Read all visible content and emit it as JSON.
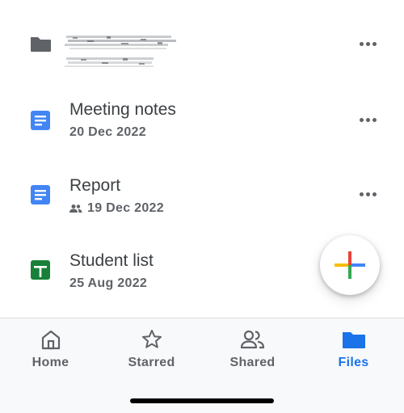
{
  "files": [
    {
      "type": "folder",
      "title": "",
      "subtitle": "",
      "shared": false
    },
    {
      "type": "doc",
      "title": "Meeting notes",
      "subtitle": "20 Dec 2022",
      "shared": false
    },
    {
      "type": "doc",
      "title": "Report",
      "subtitle": "19 Dec 2022",
      "shared": true
    },
    {
      "type": "sheet",
      "title": "Student list",
      "subtitle": "25 Aug 2022",
      "shared": false
    }
  ],
  "fab": {
    "icon": "plus-icon"
  },
  "nav": {
    "items": [
      {
        "label": "Home",
        "icon": "home-icon",
        "active": false
      },
      {
        "label": "Starred",
        "icon": "star-icon",
        "active": false
      },
      {
        "label": "Shared",
        "icon": "people-icon",
        "active": false
      },
      {
        "label": "Files",
        "icon": "folder-icon",
        "active": true
      }
    ]
  },
  "colors": {
    "accent": "#1a73e8",
    "doc": "#4285f4",
    "sheet": "#188038",
    "folder": "#5f6368"
  }
}
